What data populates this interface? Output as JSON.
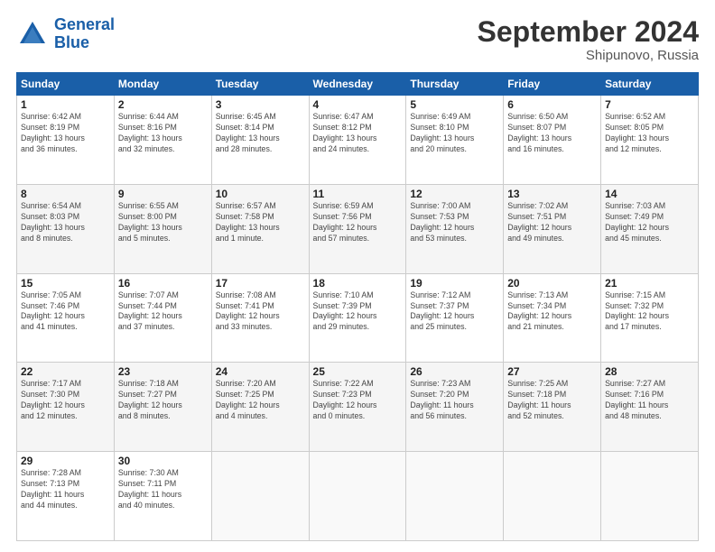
{
  "logo": {
    "line1": "General",
    "line2": "Blue"
  },
  "title": "September 2024",
  "subtitle": "Shipunovo, Russia",
  "days_of_week": [
    "Sunday",
    "Monday",
    "Tuesday",
    "Wednesday",
    "Thursday",
    "Friday",
    "Saturday"
  ],
  "weeks": [
    [
      {
        "day": "1",
        "info": "Sunrise: 6:42 AM\nSunset: 8:19 PM\nDaylight: 13 hours\nand 36 minutes."
      },
      {
        "day": "2",
        "info": "Sunrise: 6:44 AM\nSunset: 8:16 PM\nDaylight: 13 hours\nand 32 minutes."
      },
      {
        "day": "3",
        "info": "Sunrise: 6:45 AM\nSunset: 8:14 PM\nDaylight: 13 hours\nand 28 minutes."
      },
      {
        "day": "4",
        "info": "Sunrise: 6:47 AM\nSunset: 8:12 PM\nDaylight: 13 hours\nand 24 minutes."
      },
      {
        "day": "5",
        "info": "Sunrise: 6:49 AM\nSunset: 8:10 PM\nDaylight: 13 hours\nand 20 minutes."
      },
      {
        "day": "6",
        "info": "Sunrise: 6:50 AM\nSunset: 8:07 PM\nDaylight: 13 hours\nand 16 minutes."
      },
      {
        "day": "7",
        "info": "Sunrise: 6:52 AM\nSunset: 8:05 PM\nDaylight: 13 hours\nand 12 minutes."
      }
    ],
    [
      {
        "day": "8",
        "info": "Sunrise: 6:54 AM\nSunset: 8:03 PM\nDaylight: 13 hours\nand 8 minutes."
      },
      {
        "day": "9",
        "info": "Sunrise: 6:55 AM\nSunset: 8:00 PM\nDaylight: 13 hours\nand 5 minutes."
      },
      {
        "day": "10",
        "info": "Sunrise: 6:57 AM\nSunset: 7:58 PM\nDaylight: 13 hours\nand 1 minute."
      },
      {
        "day": "11",
        "info": "Sunrise: 6:59 AM\nSunset: 7:56 PM\nDaylight: 12 hours\nand 57 minutes."
      },
      {
        "day": "12",
        "info": "Sunrise: 7:00 AM\nSunset: 7:53 PM\nDaylight: 12 hours\nand 53 minutes."
      },
      {
        "day": "13",
        "info": "Sunrise: 7:02 AM\nSunset: 7:51 PM\nDaylight: 12 hours\nand 49 minutes."
      },
      {
        "day": "14",
        "info": "Sunrise: 7:03 AM\nSunset: 7:49 PM\nDaylight: 12 hours\nand 45 minutes."
      }
    ],
    [
      {
        "day": "15",
        "info": "Sunrise: 7:05 AM\nSunset: 7:46 PM\nDaylight: 12 hours\nand 41 minutes."
      },
      {
        "day": "16",
        "info": "Sunrise: 7:07 AM\nSunset: 7:44 PM\nDaylight: 12 hours\nand 37 minutes."
      },
      {
        "day": "17",
        "info": "Sunrise: 7:08 AM\nSunset: 7:41 PM\nDaylight: 12 hours\nand 33 minutes."
      },
      {
        "day": "18",
        "info": "Sunrise: 7:10 AM\nSunset: 7:39 PM\nDaylight: 12 hours\nand 29 minutes."
      },
      {
        "day": "19",
        "info": "Sunrise: 7:12 AM\nSunset: 7:37 PM\nDaylight: 12 hours\nand 25 minutes."
      },
      {
        "day": "20",
        "info": "Sunrise: 7:13 AM\nSunset: 7:34 PM\nDaylight: 12 hours\nand 21 minutes."
      },
      {
        "day": "21",
        "info": "Sunrise: 7:15 AM\nSunset: 7:32 PM\nDaylight: 12 hours\nand 17 minutes."
      }
    ],
    [
      {
        "day": "22",
        "info": "Sunrise: 7:17 AM\nSunset: 7:30 PM\nDaylight: 12 hours\nand 12 minutes."
      },
      {
        "day": "23",
        "info": "Sunrise: 7:18 AM\nSunset: 7:27 PM\nDaylight: 12 hours\nand 8 minutes."
      },
      {
        "day": "24",
        "info": "Sunrise: 7:20 AM\nSunset: 7:25 PM\nDaylight: 12 hours\nand 4 minutes."
      },
      {
        "day": "25",
        "info": "Sunrise: 7:22 AM\nSunset: 7:23 PM\nDaylight: 12 hours\nand 0 minutes."
      },
      {
        "day": "26",
        "info": "Sunrise: 7:23 AM\nSunset: 7:20 PM\nDaylight: 11 hours\nand 56 minutes."
      },
      {
        "day": "27",
        "info": "Sunrise: 7:25 AM\nSunset: 7:18 PM\nDaylight: 11 hours\nand 52 minutes."
      },
      {
        "day": "28",
        "info": "Sunrise: 7:27 AM\nSunset: 7:16 PM\nDaylight: 11 hours\nand 48 minutes."
      }
    ],
    [
      {
        "day": "29",
        "info": "Sunrise: 7:28 AM\nSunset: 7:13 PM\nDaylight: 11 hours\nand 44 minutes."
      },
      {
        "day": "30",
        "info": "Sunrise: 7:30 AM\nSunset: 7:11 PM\nDaylight: 11 hours\nand 40 minutes."
      },
      {
        "day": "",
        "info": ""
      },
      {
        "day": "",
        "info": ""
      },
      {
        "day": "",
        "info": ""
      },
      {
        "day": "",
        "info": ""
      },
      {
        "day": "",
        "info": ""
      }
    ]
  ]
}
